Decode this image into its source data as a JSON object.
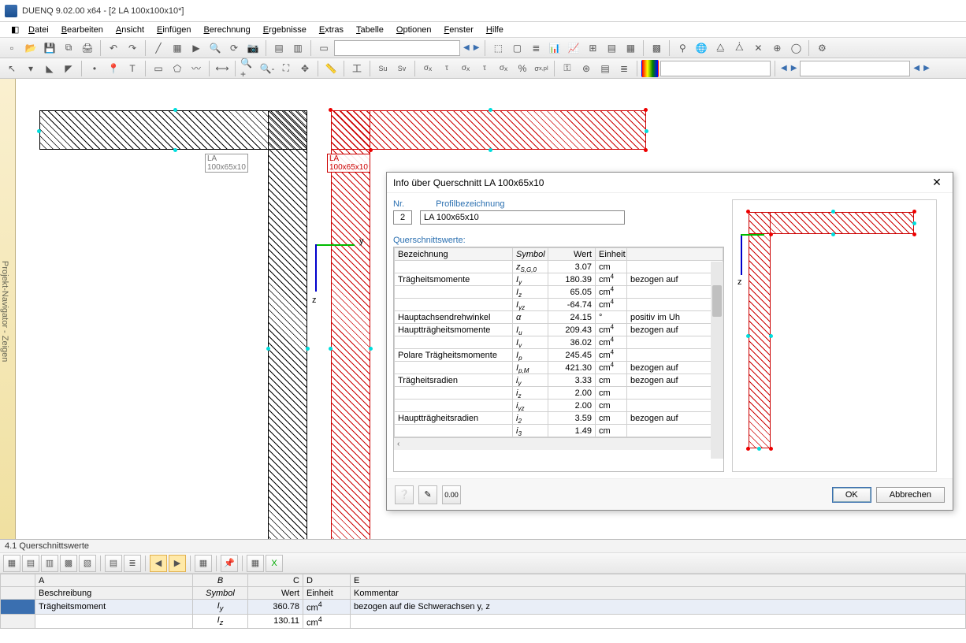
{
  "app": {
    "title": "DUENQ 9.02.00 x64 - [2 LA 100x100x10*]"
  },
  "menu": [
    "Datei",
    "Bearbeiten",
    "Ansicht",
    "Einfügen",
    "Berechnung",
    "Ergebnisse",
    "Extras",
    "Tabelle",
    "Optionen",
    "Fenster",
    "Hilfe"
  ],
  "side_tab": "Projekt-Navigator - Zeigen",
  "canvas": {
    "label_black": "LA 100x65x10",
    "label_red": "LA 100x65x10",
    "axis_z": "z",
    "axis_y": "y"
  },
  "dialog": {
    "title": "Info über Querschnitt LA 100x65x10",
    "nr_label": "Nr.",
    "nr_value": "2",
    "profil_label": "Profilbezeichnung",
    "profil_value": "LA 100x65x10",
    "qswerte": "Querschnittswerte:",
    "headers": {
      "bez": "Bezeichnung",
      "sym": "Symbol",
      "wert": "Wert",
      "ein": "Einheit"
    },
    "rows": [
      {
        "bez": "",
        "sym": "z S,G,0",
        "wert": "3.07",
        "ein": "cm",
        "rest": ""
      },
      {
        "bez": "Trägheitsmomente",
        "sym": "I y",
        "wert": "180.39",
        "ein": "cm⁴",
        "rest": "bezogen auf"
      },
      {
        "bez": "",
        "sym": "I z",
        "wert": "65.05",
        "ein": "cm⁴",
        "rest": ""
      },
      {
        "bez": "",
        "sym": "I yz",
        "wert": "-64.74",
        "ein": "cm⁴",
        "rest": ""
      },
      {
        "bez": "Hauptachsendrehwinkel",
        "sym": "α",
        "wert": "24.15",
        "ein": "°",
        "rest": "positiv im Uh"
      },
      {
        "bez": "Hauptträgheitsmomente",
        "sym": "I u",
        "wert": "209.43",
        "ein": "cm⁴",
        "rest": "bezogen auf"
      },
      {
        "bez": "",
        "sym": "I v",
        "wert": "36.02",
        "ein": "cm⁴",
        "rest": ""
      },
      {
        "bez": "Polare Trägheitsmomente",
        "sym": "I p",
        "wert": "245.45",
        "ein": "cm⁴",
        "rest": ""
      },
      {
        "bez": "",
        "sym": "I p,M",
        "wert": "421.30",
        "ein": "cm⁴",
        "rest": "bezogen auf"
      },
      {
        "bez": "Trägheitsradien",
        "sym": "i y",
        "wert": "3.33",
        "ein": "cm",
        "rest": "bezogen auf"
      },
      {
        "bez": "",
        "sym": "i z",
        "wert": "2.00",
        "ein": "cm",
        "rest": ""
      },
      {
        "bez": "",
        "sym": "i yz",
        "wert": "2.00",
        "ein": "cm",
        "rest": ""
      },
      {
        "bez": "Hauptträgheitsradien",
        "sym": "i 2",
        "wert": "3.59",
        "ein": "cm",
        "rest": "bezogen auf"
      },
      {
        "bez": "",
        "sym": "i 3",
        "wert": "1.49",
        "ein": "cm",
        "rest": ""
      }
    ],
    "ok": "OK",
    "cancel": "Abbrechen",
    "preview_axis_z": "z"
  },
  "bottom": {
    "title": "4.1 Querschnittswerte",
    "cols": {
      "A": "A",
      "B": "B",
      "C": "C",
      "D": "D",
      "E": "E"
    },
    "cols2": {
      "A": "Beschreibung",
      "B": "Symbol",
      "C": "Wert",
      "D": "Einheit",
      "E": "Kommentar"
    },
    "rows": [
      {
        "A": "Trägheitsmoment",
        "B": "I y",
        "C": "360.78",
        "D": "cm⁴",
        "E": "bezogen auf die Schwerachsen y, z",
        "sel": true
      },
      {
        "A": "",
        "B": "I z",
        "C": "130.11",
        "D": "cm⁴",
        "E": ""
      }
    ]
  }
}
